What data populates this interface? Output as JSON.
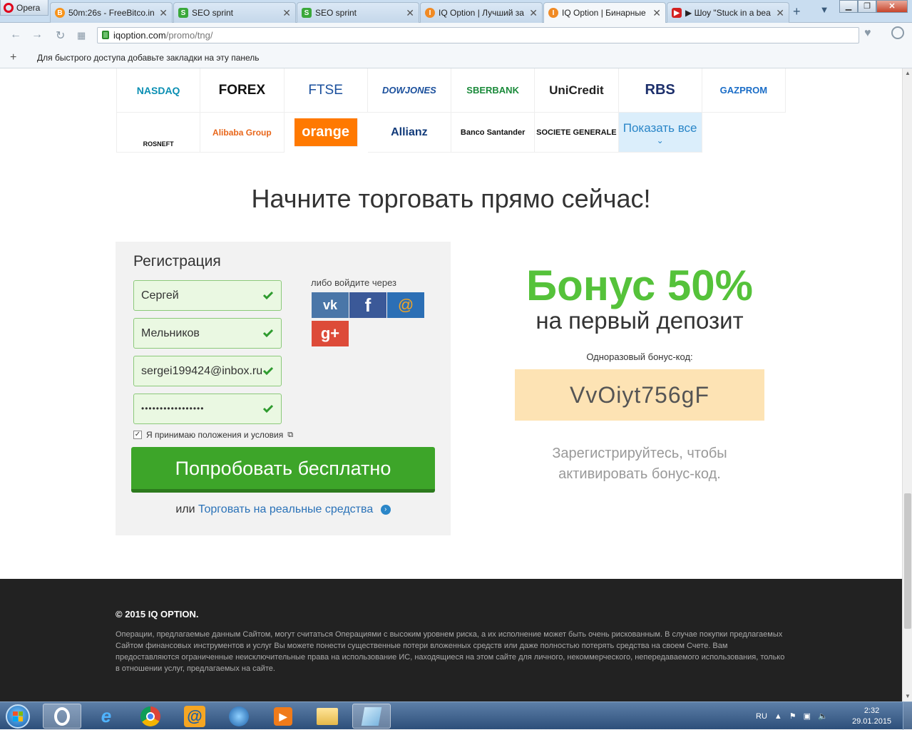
{
  "browser": {
    "opera_label": "Opera",
    "tabs": [
      {
        "title": "50m:26s - FreeBitco.in",
        "icon": "bitcoin-icon",
        "color": "#f7931a",
        "glyph": "B"
      },
      {
        "title": "SEO sprint",
        "icon": "seosprint-icon",
        "color": "#3aa83a",
        "glyph": "S"
      },
      {
        "title": "SEO sprint",
        "icon": "seosprint-icon",
        "color": "#3aa83a",
        "glyph": "S"
      },
      {
        "title": "IQ Option | Лучший за",
        "icon": "iqoption-icon",
        "color": "#f08a24",
        "glyph": "I"
      },
      {
        "title": "IQ Option | Бинарные",
        "icon": "iqoption-icon",
        "color": "#f08a24",
        "glyph": "I"
      },
      {
        "title": "▶ Шоу \"Stuck in a bea",
        "icon": "youtube-icon",
        "color": "#d32020",
        "glyph": "▶"
      }
    ],
    "url_host": "iqoption.com",
    "url_path": "/promo/tng/",
    "bookmarks_hint": "Для быстрого доступа добавьте закладки на эту панель"
  },
  "logos": [
    "NASDAQ",
    "FOREX",
    "FTSE",
    "DOWJONES",
    "SBERBANK",
    "UniCredit",
    "RBS",
    "GAZPROM",
    "ROSNEFT",
    "Alibaba Group",
    "orange",
    "Allianz",
    "Banco Santander",
    "SOCIETE GENERALE"
  ],
  "show_all": "Показать все",
  "cta_title": "Начните торговать прямо сейчас!",
  "registration": {
    "title": "Регистрация",
    "first_name": "Сергей",
    "last_name": "Мельников",
    "email": "sergei199424@inbox.ru",
    "password": "•••••••••••••••••",
    "social_label": "либо войдите через",
    "agree_label": "Я принимаю положения и условия",
    "agree_checked": "✓",
    "try_button": "Попробовать бесплатно",
    "or_label": "или",
    "real_link": "Торговать на реальные средства"
  },
  "bonus": {
    "title": "Бонус 50%",
    "subtitle": "на первый депозит",
    "code_label": "Одноразовый бонус-код:",
    "code": "VvOiyt756gF",
    "hint": "Зарегистрируйтесь, чтобы активировать бонус-код."
  },
  "footer": {
    "copyright": "© 2015 IQ OPTION.",
    "disclaimer": "Операции, предлагаемые данным Сайтом, могут считаться Операциями с высоким уровнем риска, а их исполнение может быть очень рискованным. В случае покупки предлагаемых Сайтом финансовых инструментов и услуг Вы можете понести существенные потери вложенных средств или даже полностью потерять средства на своем Счете. Вам предоставляются ограниченные неисключительные права на использование ИС, находящиеся на этом сайте для личного, некоммерческого, непередаваемого использования, только в отношении услуг, предлагаемых на сайте."
  },
  "taskbar": {
    "lang": "RU",
    "time": "2:32",
    "date": "29.01.2015"
  },
  "colors": {
    "accent_green": "#3da529",
    "bonus_green": "#55c23a",
    "code_bg": "#fde3b4",
    "link_blue": "#2a72b8"
  }
}
